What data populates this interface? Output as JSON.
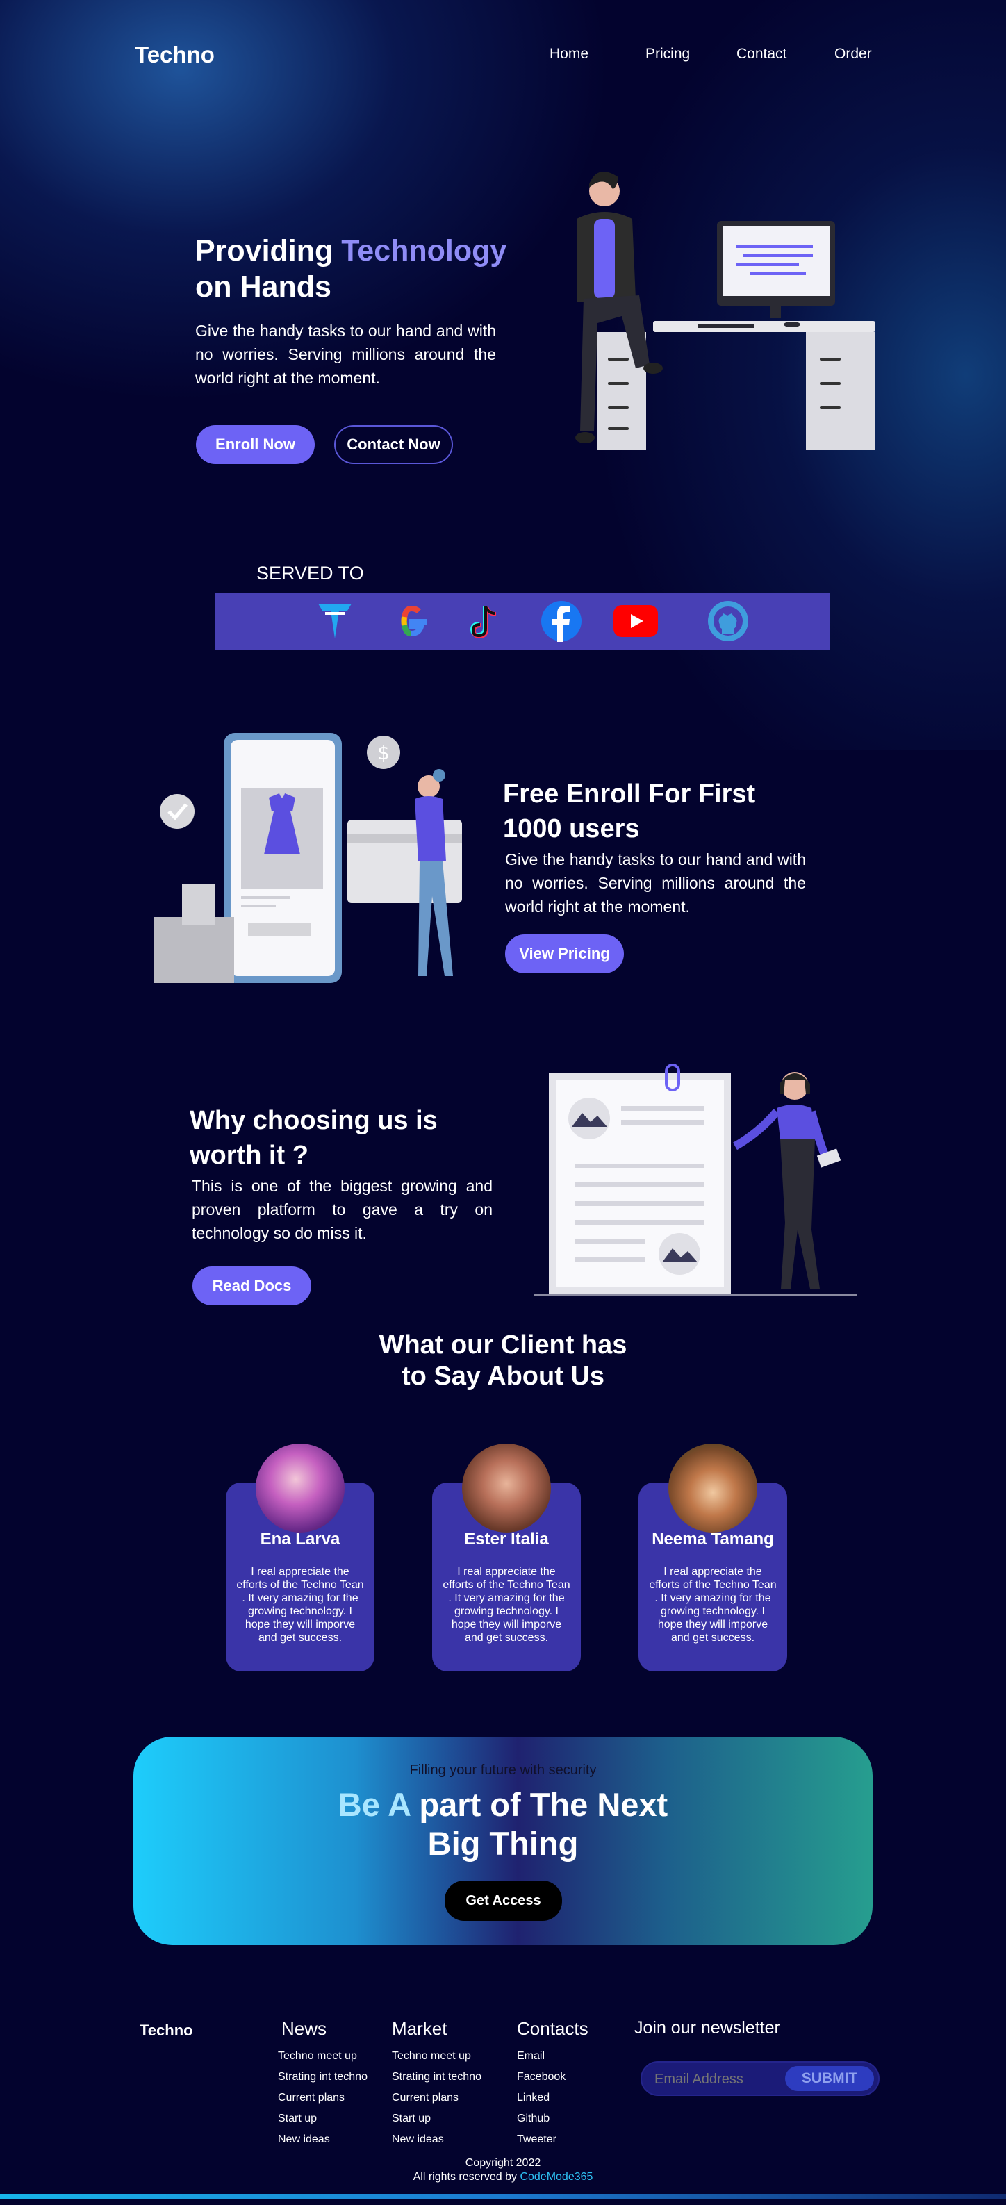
{
  "brand": "Techno",
  "nav": [
    "Home",
    "Pricing",
    "Contact",
    "Order"
  ],
  "hero": {
    "title_part1": "Providing ",
    "title_accent": "Technology",
    "title_part2": "on Hands",
    "text": "Give the handy tasks to our hand and with no worries. Serving millions around the world right at the moment.",
    "primary_button": "Enroll Now",
    "secondary_button": "Contact Now"
  },
  "served": {
    "title": "SERVED TO",
    "logos": [
      "veritasium-logo",
      "google-logo",
      "tiktok-logo",
      "facebook-logo",
      "youtube-logo",
      "github-logo"
    ]
  },
  "enroll": {
    "title": "Free Enroll For First 1000 users",
    "text": "Give the handy tasks to our hand and with no worries. Serving millions around the world right at the moment.",
    "button": "View Pricing"
  },
  "why": {
    "title": "Why choosing us is worth it ?",
    "text": "This is one of the biggest growing and proven platform to gave a try on technology so do miss it.",
    "button": "Read Docs"
  },
  "clients": {
    "title_line1": "What our Client has",
    "title_line2": "to Say About Us",
    "items": [
      {
        "name": "Ena Larva",
        "quote": "I real appreciate the efforts of the Techno Tean . It very amazing for the growing technology. I hope they will imporve and get success."
      },
      {
        "name": "Ester Italia",
        "quote": "I real appreciate the efforts of the Techno Tean . It very amazing for the growing technology. I hope they will imporve and get success."
      },
      {
        "name": "Neema Tamang",
        "quote": "I real appreciate the efforts of the Techno Tean . It very amazing for the growing technology. I hope they will imporve and get success."
      }
    ]
  },
  "cta": {
    "kicker": "Filling your future with security",
    "title_accent": "Be A",
    "title_rest1": " part of The Next",
    "title_line2": "Big Thing",
    "button": "Get Access"
  },
  "footer": {
    "brand": "Techno",
    "columns": [
      {
        "title": "News",
        "links": [
          "Techno meet up",
          "Strating int techno",
          "Current plans",
          "Start up",
          "New ideas"
        ]
      },
      {
        "title": "Market",
        "links": [
          "Techno meet up",
          "Strating int techno",
          "Current plans",
          "Start up",
          "New ideas"
        ]
      },
      {
        "title": "Contacts",
        "links": [
          "Email",
          "Facebook",
          "Linked",
          "Github",
          "Tweeter"
        ]
      }
    ],
    "newsletter_title": "Join our newsletter",
    "email_placeholder": "Email Address",
    "submit": "SUBMIT",
    "copyright": "Copyright 2022",
    "rights": "All rights reserved by ",
    "credit": "CodeMode365"
  },
  "colors": {
    "background": "#03032e",
    "accent": "#6d63f5",
    "card": "#3a34a8",
    "served_bar": "#4840b5"
  }
}
